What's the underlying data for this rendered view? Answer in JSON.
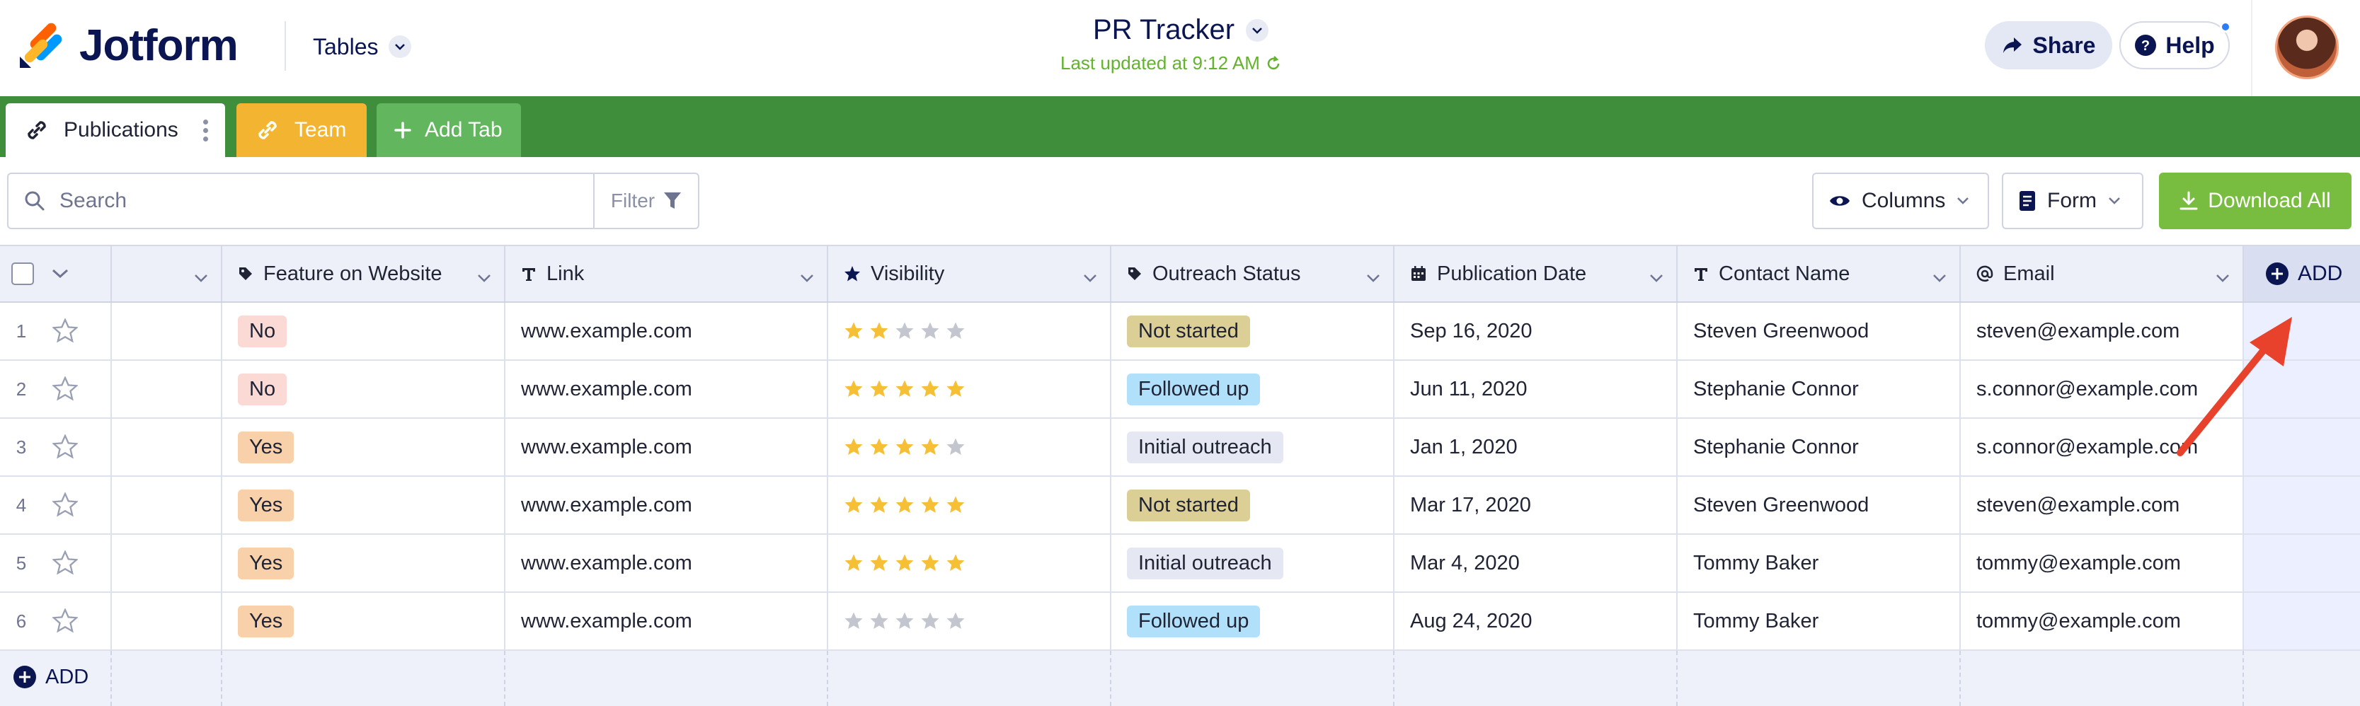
{
  "header": {
    "brand": "Jotform",
    "tables_menu": "Tables",
    "title": "PR Tracker",
    "last_updated": "Last updated at 9:12 AM",
    "share_label": "Share",
    "help_label": "Help"
  },
  "tabs": [
    {
      "label": "Publications"
    },
    {
      "label": "Team"
    },
    {
      "label": "Add Tab"
    }
  ],
  "toolbar": {
    "search_placeholder": "Search",
    "filter_label": "Filter",
    "columns_label": "Columns",
    "form_label": "Form",
    "download_label": "Download All"
  },
  "columns": [
    {
      "label": "",
      "icon": "none"
    },
    {
      "label": "Feature on Website",
      "icon": "tag-icon"
    },
    {
      "label": "Link",
      "icon": "text-icon"
    },
    {
      "label": "Visibility",
      "icon": "star-icon"
    },
    {
      "label": "Outreach Status",
      "icon": "tag-icon"
    },
    {
      "label": "Publication Date",
      "icon": "calendar-icon"
    },
    {
      "label": "Contact Name",
      "icon": "text-icon"
    },
    {
      "label": "Email",
      "icon": "at-icon"
    }
  ],
  "add_column_label": "ADD",
  "add_row_label": "ADD",
  "rows": [
    {
      "num": "1",
      "feature": "No",
      "link": "www.example.com",
      "visibility": 2,
      "status": "Not started",
      "date": "Sep 16, 2020",
      "contact": "Steven Greenwood",
      "email": "steven@example.com"
    },
    {
      "num": "2",
      "feature": "No",
      "link": "www.example.com",
      "visibility": 5,
      "status": "Followed up",
      "date": "Jun 11, 2020",
      "contact": "Stephanie Connor",
      "email": "s.connor@example.com"
    },
    {
      "num": "3",
      "feature": "Yes",
      "link": "www.example.com",
      "visibility": 4,
      "status": "Initial outreach",
      "date": "Jan 1, 2020",
      "contact": "Stephanie Connor",
      "email": "s.connor@example.com"
    },
    {
      "num": "4",
      "feature": "Yes",
      "link": "www.example.com",
      "visibility": 5,
      "status": "Not started",
      "date": "Mar 17, 2020",
      "contact": "Steven Greenwood",
      "email": "steven@example.com"
    },
    {
      "num": "5",
      "feature": "Yes",
      "link": "www.example.com",
      "visibility": 5,
      "status": "Initial outreach",
      "date": "Mar 4, 2020",
      "contact": "Tommy Baker",
      "email": "tommy@example.com"
    },
    {
      "num": "6",
      "feature": "Yes",
      "link": "www.example.com",
      "visibility": 0,
      "status": "Followed up",
      "date": "Aug 24, 2020",
      "contact": "Tommy Baker",
      "email": "tommy@example.com"
    }
  ],
  "colors": {
    "tab_bar": "#3f8e3c",
    "team_tab": "#f3b531",
    "add_tab": "#62b75e",
    "download": "#78bd3f",
    "star_filled": "#f5c035",
    "star_empty": "#c3c6cf",
    "arrow": "#e8412c"
  }
}
